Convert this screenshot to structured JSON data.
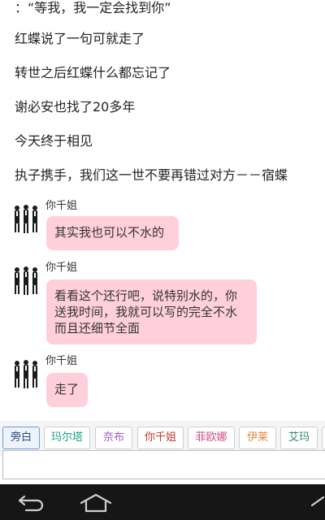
{
  "story_lines": [
    "：“等我，我一定会找到你”",
    "红蝶说了一句可就走了",
    "转世之后红蝶什么都忘记了",
    "谢必安也找了20多年",
    "今天终于相见",
    "执子携手，我们这一世不要再错过对方－－宿蝶"
  ],
  "messages": [
    {
      "sender": "你千姐",
      "text": "其实我也可以不水的"
    },
    {
      "sender": "你千姐",
      "text_lines": [
        "看看这个还行吧，说特别水的，你",
        "送我时间，我就可以写的完全不水",
        "而且还细节全面"
      ]
    },
    {
      "sender": "你千姐",
      "text": "走了"
    }
  ],
  "characters": [
    {
      "label": "旁白",
      "color": "#2c4a7a"
    },
    {
      "label": "玛尔塔",
      "color": "#1aa38a"
    },
    {
      "label": "奈布",
      "color": "#9a5fc0"
    },
    {
      "label": "你千姐",
      "color": "#c0392b"
    },
    {
      "label": "菲欧娜",
      "color": "#d04a8a"
    },
    {
      "label": "伊莱",
      "color": "#e08a3a"
    },
    {
      "label": "艾玛",
      "color": "#2f8f6a"
    }
  ],
  "colors": {
    "bubble": "#ffd0dc",
    "navbar": "#161616"
  },
  "icons": [
    "back-icon",
    "home-icon"
  ]
}
